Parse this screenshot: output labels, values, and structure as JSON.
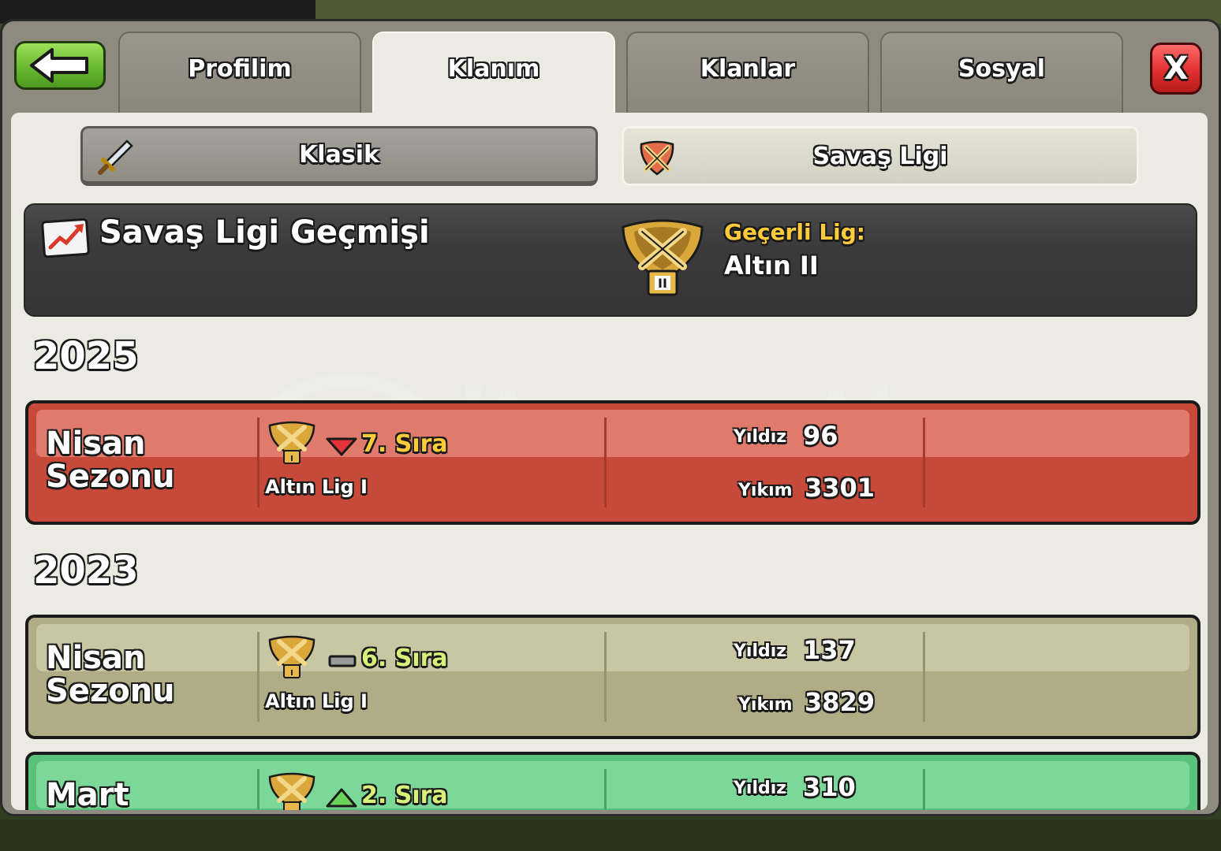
{
  "tabs": [
    "Profilim",
    "Klanım",
    "Klanlar",
    "Sosyal"
  ],
  "active_tab": "Klanım",
  "close_label": "X",
  "subtabs": {
    "klasik": "Klasik",
    "savas": "Savaş Ligi"
  },
  "history": {
    "title": "Savaş Ligi Geçmişi",
    "league_label": "Geçerli Lig:",
    "league_value": "Altın II"
  },
  "years": [
    "2025",
    "2023"
  ],
  "seasons": [
    {
      "name_line1": "Nisan",
      "name_line2": "Sezonu",
      "rank": "7. Sıra",
      "trend": "down",
      "league": "Altın Lig I",
      "stars_label": "Yıldız",
      "stars": "96",
      "destruction_label": "Yıkım",
      "destruction": "3301",
      "color": "#c6493a"
    },
    {
      "name_line1": "Nisan",
      "name_line2": "Sezonu",
      "rank": "6. Sıra",
      "trend": "same",
      "league": "Altın Lig I",
      "stars_label": "Yıldız",
      "stars": "137",
      "destruction_label": "Yıkım",
      "destruction": "3829",
      "color": "#b0ad86"
    },
    {
      "name_line1": "Mart",
      "name_line2": "",
      "rank": "2. Sıra",
      "trend": "up",
      "league": "",
      "stars_label": "Yıldız",
      "stars": "310",
      "destruction_label": "",
      "destruction": "",
      "color": "#58c27a"
    }
  ],
  "watermark": {
    "brand": "itemsatis",
    "tagline": "HESAP / SKIN / ITEM / E-PIN",
    "suffix": ".com"
  },
  "icons": {
    "back": "back-arrow-icon",
    "klasik": "sword-icon",
    "savas": "crossed-swords-icon",
    "history": "trend-chart-icon",
    "league": "gold-league-badge-icon"
  },
  "colors": {
    "rank_text": "#ffcb3a",
    "rank_text_same": "#d6f07a",
    "rank_text_up": "#d6f07a",
    "league_label": "#ffcb3a"
  }
}
